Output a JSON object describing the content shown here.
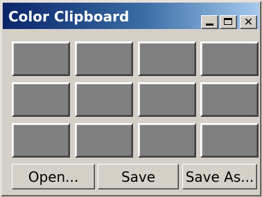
{
  "window": {
    "title": "Color Clipboard",
    "controls": [
      "minimize-icon",
      "maximize-icon",
      "close-icon"
    ]
  },
  "swatches": {
    "rows": 3,
    "columns": 4,
    "colors": [
      [
        "#808080",
        "#808080",
        "#808080",
        "#808080"
      ],
      [
        "#808080",
        "#808080",
        "#808080",
        "#808080"
      ],
      [
        "#808080",
        "#808080",
        "#808080",
        "#808080"
      ]
    ]
  },
  "buttons": {
    "open_label": "Open...",
    "save_label": "Save",
    "save_as_label": "Save As..."
  }
}
